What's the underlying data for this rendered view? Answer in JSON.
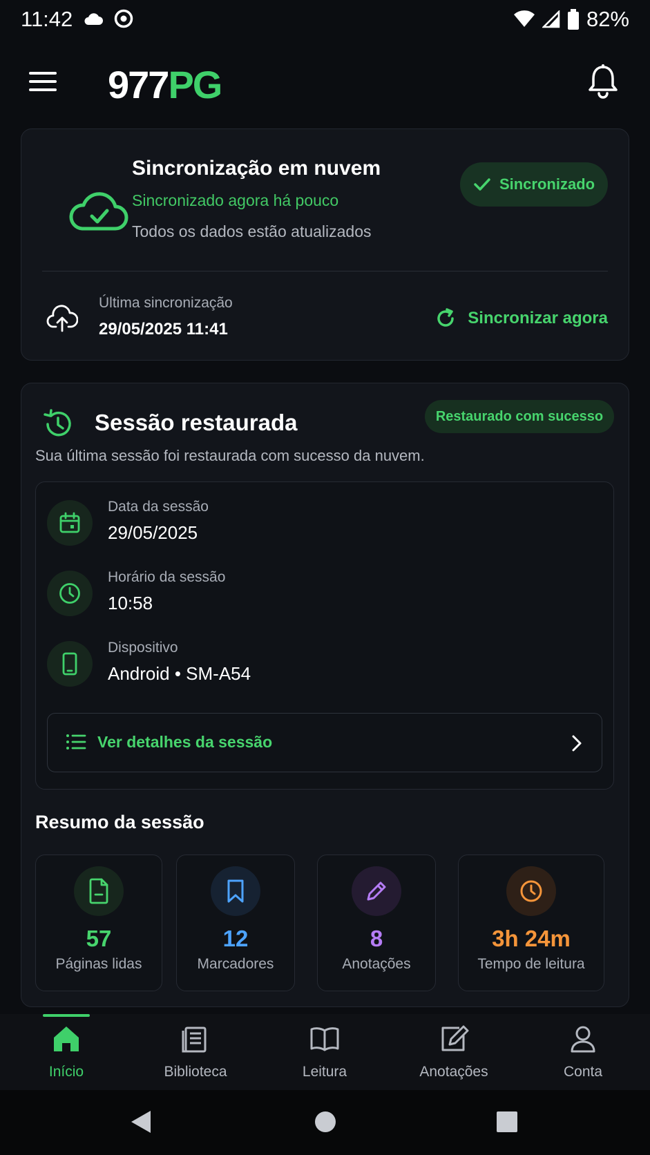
{
  "status_bar": {
    "time": "11:42",
    "battery": "82%"
  },
  "app_bar": {
    "logo_part1": "977",
    "logo_part2": "PG"
  },
  "sync_card": {
    "title": "Sincronização em nuvem",
    "subtitle": "Sincronizado agora há pouco",
    "description": "Todos os dados estão atualizados",
    "badge": "Sincronizado",
    "last_sync_label": "Última sincronização",
    "last_sync_value": "29/05/2025 11:41",
    "sync_now": "Sincronizar agora"
  },
  "session_card": {
    "title": "Sessão restaurada",
    "badge": "Restaurado com sucesso",
    "description": "Sua última sessão foi restaurada com sucesso da nuvem.",
    "info": [
      {
        "label": "Data da sessão",
        "value": "29/05/2025",
        "icon": "calendar-icon"
      },
      {
        "label": "Horário da sessão",
        "value": "10:58",
        "icon": "clock-icon"
      },
      {
        "label": "Dispositivo",
        "value": "Android • SM-A54",
        "icon": "phone-icon"
      }
    ],
    "details_button": "Ver detalhes da sessão",
    "summary_title": "Resumo da sessão",
    "stats": [
      {
        "value": "57",
        "label": "Páginas lidas",
        "color": "#47d46d",
        "icon": "document-icon"
      },
      {
        "value": "12",
        "label": "Marcadores",
        "color": "#4da3ff",
        "icon": "bookmark-icon"
      },
      {
        "value": "8",
        "label": "Anotações",
        "color": "#b57cf5",
        "icon": "pencil-icon"
      },
      {
        "value": "3h 24m",
        "label": "Tempo de leitura",
        "color": "#f5953a",
        "icon": "clock-icon"
      }
    ]
  },
  "bottom_nav": {
    "items": [
      {
        "label": "Início",
        "icon": "home-icon",
        "active": true
      },
      {
        "label": "Biblioteca",
        "icon": "library-icon",
        "active": false
      },
      {
        "label": "Leitura",
        "icon": "book-icon",
        "active": false
      },
      {
        "label": "Anotações",
        "icon": "edit-icon",
        "active": false
      },
      {
        "label": "Conta",
        "icon": "user-icon",
        "active": false
      }
    ]
  },
  "colors": {
    "accent": "#3fd06a",
    "background": "#0b0d11",
    "card": "#12151b"
  }
}
